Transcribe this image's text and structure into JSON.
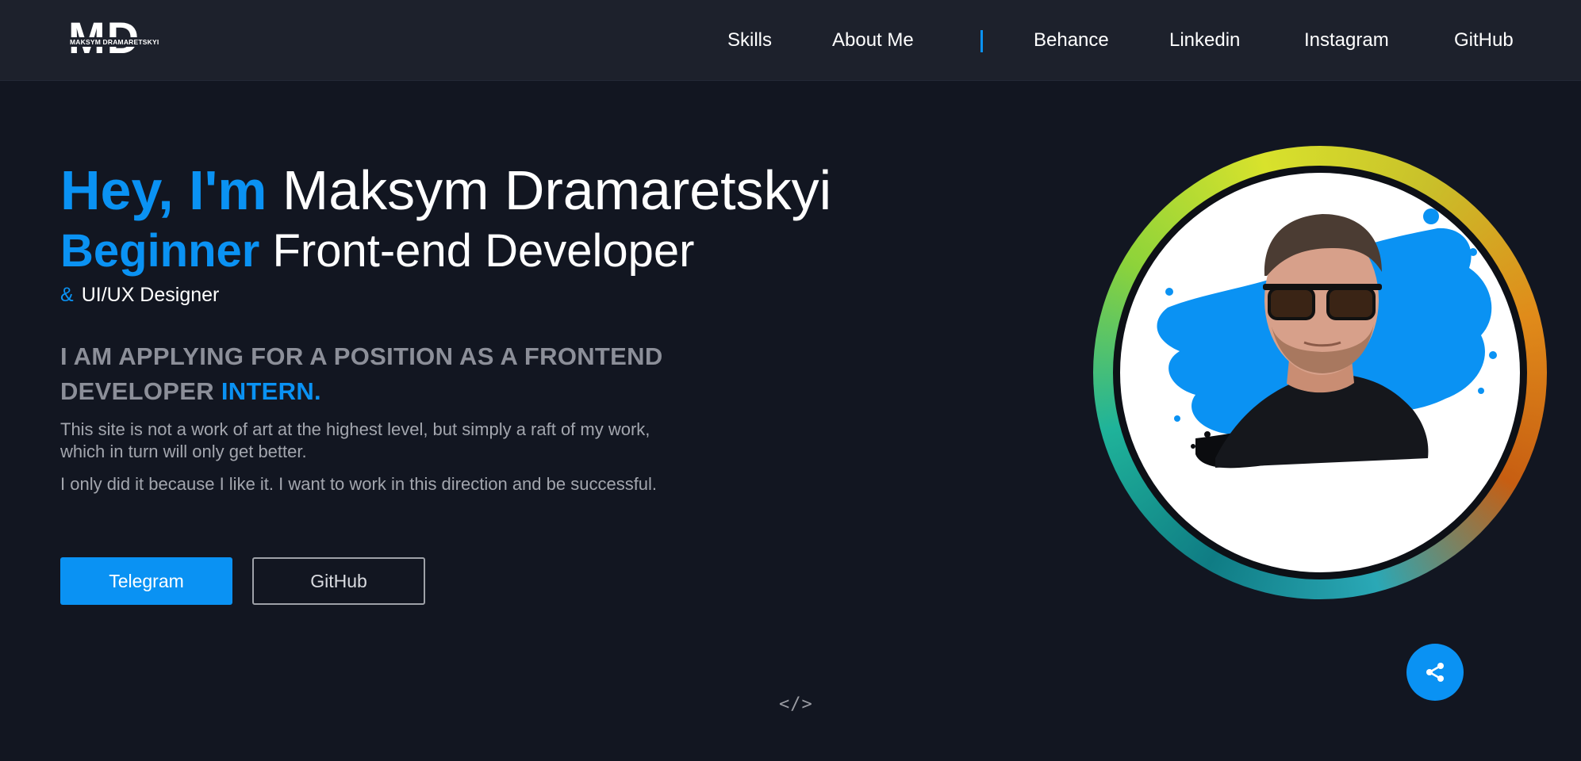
{
  "logo": {
    "letters": "MD",
    "subtitle": "MAKSYM DRAMARETSKYI"
  },
  "nav": {
    "items": [
      {
        "label": "Skills"
      },
      {
        "label": "About Me"
      }
    ],
    "social": [
      {
        "label": "Behance"
      },
      {
        "label": "Linkedin"
      },
      {
        "label": "Instagram"
      },
      {
        "label": "GitHub"
      }
    ]
  },
  "hero": {
    "greeting_accent": "Hey, I'm",
    "name": "Maksym Dramaretskyi",
    "role_accent": "Beginner",
    "role": "Front-end Developer",
    "amp": "&",
    "secondary_role": "UI/UX Designer",
    "headline": "I AM APPLYING FOR A POSITION AS A FRONTEND DEVELOPER",
    "headline_accent": "INTERN.",
    "paragraphs": [
      "This site is not a work of art at the highest level, but simply a raft of my work, which in turn will only get better.",
      "I only did it because I like it. I want to work in this direction and be successful."
    ],
    "buttons": {
      "telegram": "Telegram",
      "github": "GitHub"
    }
  },
  "footer": {
    "code_symbol": "</>"
  },
  "icons": {
    "share": "share-icon",
    "code": "code-icon"
  },
  "colors": {
    "accent": "#0a92f3",
    "background": "#121621",
    "navbar": "#1d212c"
  }
}
